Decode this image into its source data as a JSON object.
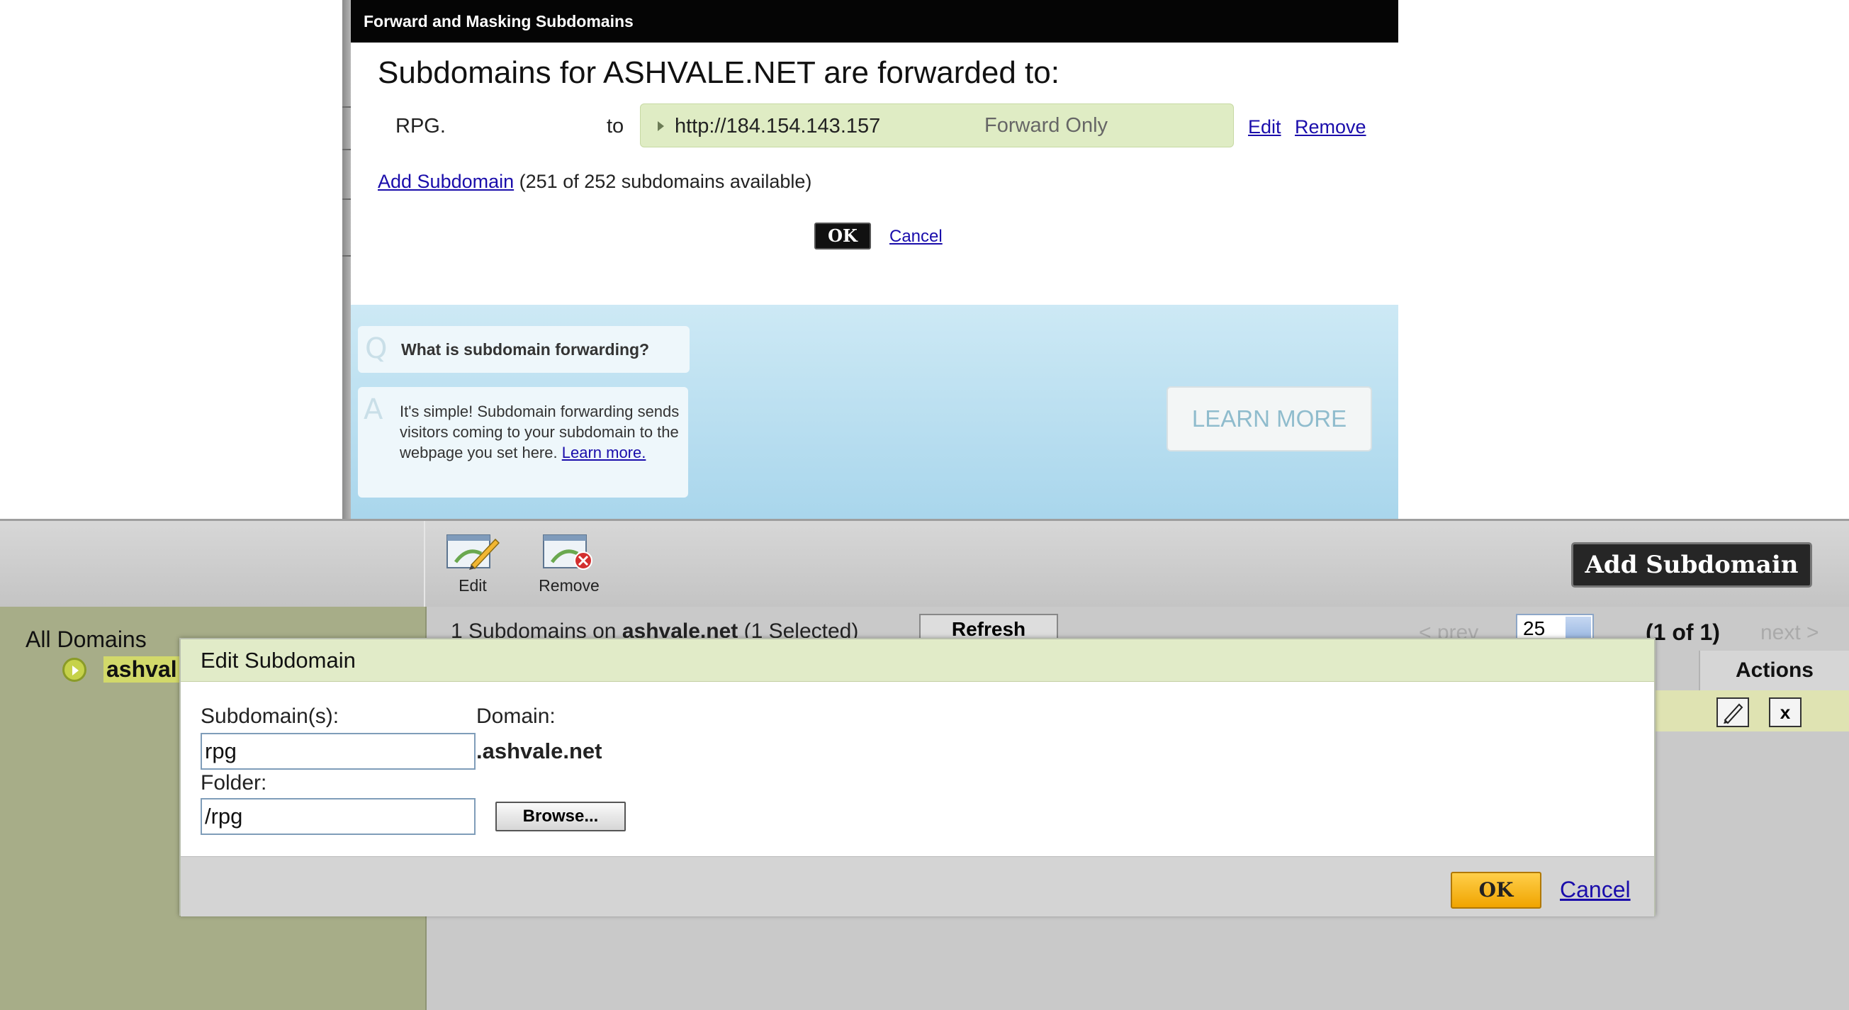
{
  "forward_dialog": {
    "title": "Forward and Masking Subdomains",
    "heading": "Subdomains for ASHVALE.NET are forwarded to:",
    "subdomain": "RPG.",
    "to_label": "to",
    "target_url": "http://184.154.143.157",
    "forward_type": "Forward Only",
    "edit_link": "Edit",
    "remove_link": "Remove",
    "add_subdomain_link": "Add Subdomain",
    "availability": "(251 of 252 subdomains available)",
    "ok_button": "OK",
    "cancel_link": "Cancel"
  },
  "faq": {
    "question": "What is subdomain forwarding?",
    "answer": "It's simple! Subdomain forwarding sends visitors coming to your subdomain to the webpage you set here.",
    "answer_link": "Learn more.",
    "learn_more_button": "LEARN MORE"
  },
  "manager": {
    "toolbar": {
      "edit_label": "Edit",
      "remove_label": "Remove",
      "add_subdomain_button": "Add Subdomain"
    },
    "sidebar": {
      "all_domains": "All Domains",
      "domain_name": "ashval"
    },
    "list": {
      "count_prefix": "1 Subdomains on ",
      "count_domain": "ashvale.net",
      "count_suffix": " (1 Selected)",
      "refresh_button": "Refresh",
      "prev_link": "< prev",
      "page_size": "25",
      "page_count": "(1 of 1)",
      "next_link": "next >",
      "actions_header": "Actions",
      "delete_glyph": "x"
    }
  },
  "edit_subdomain": {
    "title": "Edit Subdomain",
    "subdomain_label": "Subdomain(s):",
    "subdomain_value": "rpg",
    "domain_label": "Domain:",
    "domain_value": ".ashvale.net",
    "folder_label": "Folder:",
    "folder_value": "/rpg",
    "browse_button": "Browse...",
    "ok_button": "OK",
    "cancel_link": "Cancel"
  },
  "icons": {
    "faq_question": "q-letter-icon",
    "faq_answer": "a-letter-icon",
    "tool_edit": "edit-pencil-icon",
    "tool_remove": "remove-icon",
    "domain_bullet": "arrow-circle-icon",
    "row_edit": "pencil-icon",
    "row_delete": "x-icon"
  },
  "colors": {
    "forward_target_bg": "#dfecc4",
    "faq_bg": "#a9d6ec",
    "sidebar_bg": "#a7ad88",
    "edit_header_bg": "#e1ebc8",
    "ok_button_bg": "#f0a400",
    "row_highlight": "#dfe3b2"
  }
}
